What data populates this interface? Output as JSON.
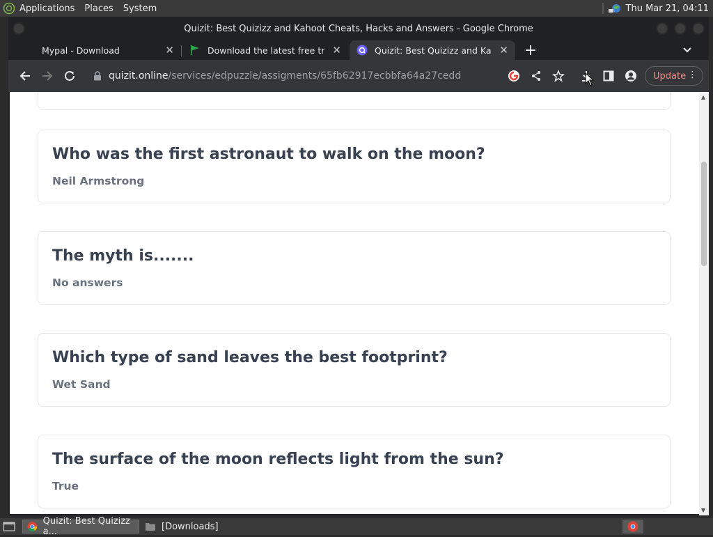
{
  "top_panel": {
    "menus": [
      "Applications",
      "Places",
      "System"
    ],
    "clock": "Thu Mar 21, 04:11"
  },
  "window": {
    "title": "Quizit: Best Quizizz and Kahoot Cheats, Hacks and Answers - Google Chrome"
  },
  "tabs": [
    {
      "label": "Mypal - Download",
      "icon": "blank-page-icon"
    },
    {
      "label": "Download the latest free trial",
      "icon": "green-flag-icon"
    },
    {
      "label": "Quizit: Best Quizizz and Kahoot",
      "icon": "quizit-logo-icon"
    }
  ],
  "toolbar": {
    "url_domain": "quizit.online",
    "url_path": "/services/edpuzzle/assigments/65fb62917ecbbfa64a27cedd",
    "update_label": "Update"
  },
  "questions": [
    {
      "question": "Who was the first astronaut to walk on the moon?",
      "answer": "Neil Armstrong"
    },
    {
      "question": "The myth is.......",
      "answer": "No answers"
    },
    {
      "question": "Which type of sand leaves the best footprint?",
      "answer": "Wet Sand"
    },
    {
      "question": "The surface of the moon reflects light from the sun?",
      "answer": "True"
    }
  ],
  "taskbar": {
    "items": [
      "Quizit: Best Quizizz a...",
      "[Downloads]"
    ]
  },
  "colors": {
    "accent_update": "#f28b82",
    "question_text": "#374151",
    "answer_text": "#6b7280"
  }
}
